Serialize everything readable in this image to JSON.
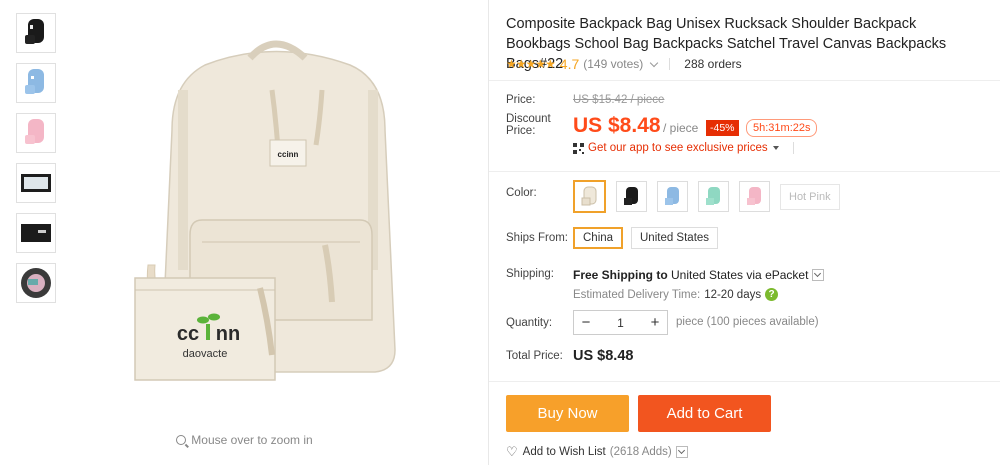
{
  "product": {
    "title": "Composite Backpack Bag Unisex Rucksack Shoulder Backpack Bookbags School Bag Backpacks Satchel Travel Canvas Backpacks Bags#22",
    "stars": "★★★★★",
    "rating": "4.7",
    "votes": "(149 votes)",
    "orders": "288 orders",
    "brand_text_top": "ccinn",
    "brand_text_bottom": "daovacte"
  },
  "gallery": {
    "thumbnails": [
      "black-backpack",
      "blue-backpack",
      "pink-backpack",
      "black-pencil-case",
      "black-purse",
      "interior-view"
    ],
    "zoom_hint": "Mouse over to zoom in"
  },
  "price": {
    "label": "Price:",
    "original": "US $15.42 / piece",
    "discount_label_1": "Discount",
    "discount_label_2": "Price:",
    "current": "US $8.48",
    "unit": "/ piece",
    "discount_badge": "-45%",
    "countdown": "5h:31m:22s",
    "app_promo": "Get our app to see exclusive prices"
  },
  "options": {
    "color_label": "Color:",
    "color_text_option": "Hot Pink",
    "ships_from_label": "Ships From:",
    "ships_from": [
      "China",
      "United States"
    ],
    "shipping_label": "Shipping:",
    "shipping_bold": "Free Shipping to",
    "shipping_rest": "United States via ePacket",
    "delivery_label": "Estimated Delivery Time:",
    "delivery_days": "12-20 days",
    "help_symbol": "?",
    "quantity_label": "Quantity:",
    "quantity_minus": "−",
    "quantity_value": "1",
    "quantity_plus": "+",
    "quantity_note": "piece (100 pieces available)",
    "total_label": "Total Price:",
    "total_value": "US $8.48"
  },
  "actions": {
    "buy_now": "Buy Now",
    "add_to_cart": "Add to Cart",
    "wishlist": "Add to Wish List",
    "wishlist_count": "(2618 Adds)"
  },
  "colors": {
    "accent_orange": "#f7a02a",
    "cart_red": "#f2551f",
    "price_red": "#ff4b1a",
    "badge_red": "#e62e04",
    "star_gold": "#f5a623",
    "selected_border": "#f0a12a"
  }
}
